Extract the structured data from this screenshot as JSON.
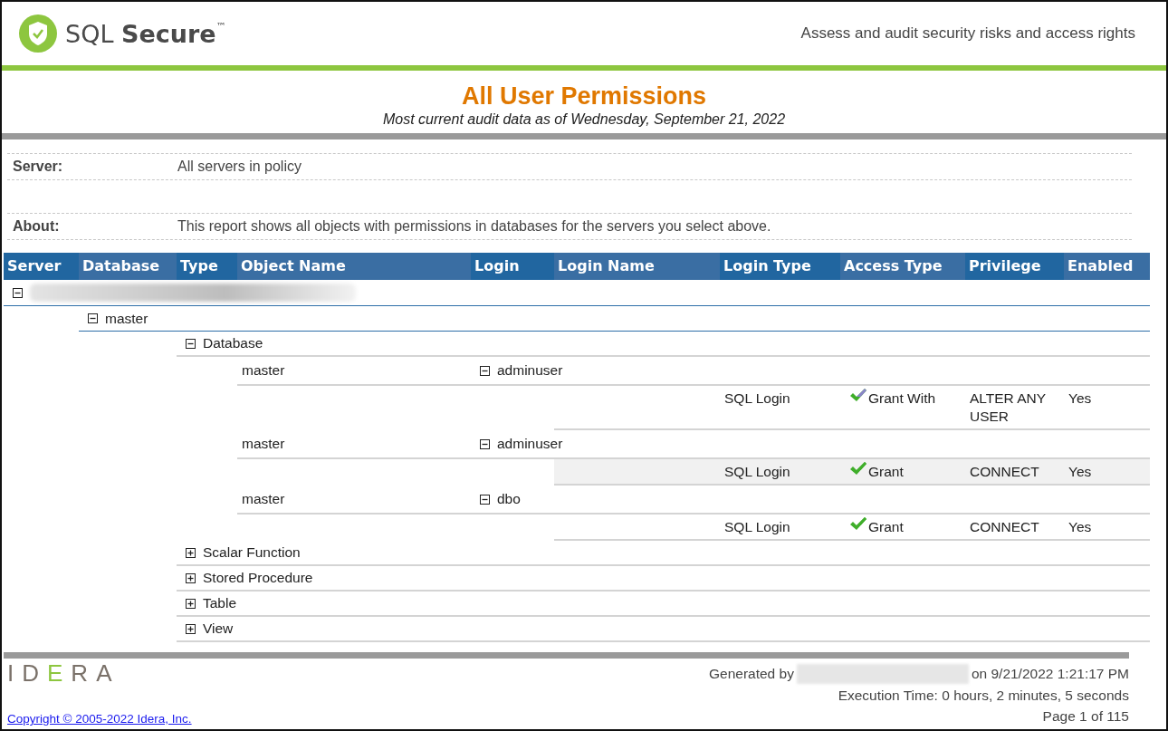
{
  "header": {
    "product": "SQL",
    "product_bold": "Secure",
    "trademark": "™",
    "tagline": "Assess and audit security risks and access rights"
  },
  "report": {
    "title": "All User Permissions",
    "subtitle": "Most current audit data as of Wednesday, September 21, 2022"
  },
  "parameters": [
    {
      "label": "Server:",
      "value": "All servers in policy"
    },
    {
      "label": "About:",
      "value": "This report shows all objects with permissions in databases for the servers you select above."
    }
  ],
  "table": {
    "columns": [
      "Server",
      "Database",
      "Type",
      "Object Name",
      "Login",
      "Login Name",
      "Login Type",
      "Access Type",
      "Privilege",
      "Enabled"
    ],
    "servers": [
      {
        "expanded": true,
        "databases": [
          {
            "name": "master",
            "expanded": true,
            "types": [
              {
                "type": "Database",
                "expanded": true,
                "objects": [
                  {
                    "object_name": "master",
                    "login": "adminuser",
                    "expanded": true,
                    "permissions": [
                      {
                        "login_type": "SQL Login",
                        "kind": "grant_with",
                        "access_type": "Grant With",
                        "privilege": "ALTER ANY USER",
                        "enabled": "Yes",
                        "shaded": false
                      }
                    ]
                  },
                  {
                    "object_name": "master",
                    "login": "adminuser",
                    "expanded": true,
                    "permissions": [
                      {
                        "login_type": "SQL Login",
                        "kind": "grant",
                        "access_type": "Grant",
                        "privilege": "CONNECT",
                        "enabled": "Yes",
                        "shaded": true
                      }
                    ]
                  },
                  {
                    "object_name": "master",
                    "login": "dbo",
                    "expanded": true,
                    "permissions": [
                      {
                        "login_type": "SQL Login",
                        "kind": "grant",
                        "access_type": "Grant",
                        "privilege": "CONNECT",
                        "enabled": "Yes",
                        "shaded": false
                      }
                    ]
                  }
                ]
              },
              {
                "type": "Scalar Function",
                "expanded": false
              },
              {
                "type": "Stored Procedure",
                "expanded": false
              },
              {
                "type": "Table",
                "expanded": false
              },
              {
                "type": "View",
                "expanded": false
              }
            ]
          }
        ]
      }
    ]
  },
  "footer": {
    "logo": "IDERA",
    "generated_prefix": "Generated by",
    "generated_suffix": "on 9/21/2022 1:21:17 PM",
    "execution_time": "Execution Time: 0 hours, 2 minutes, 5 seconds",
    "copyright": "Copyright © 2005-2022 Idera, Inc.",
    "page": "Page 1 of 115"
  }
}
